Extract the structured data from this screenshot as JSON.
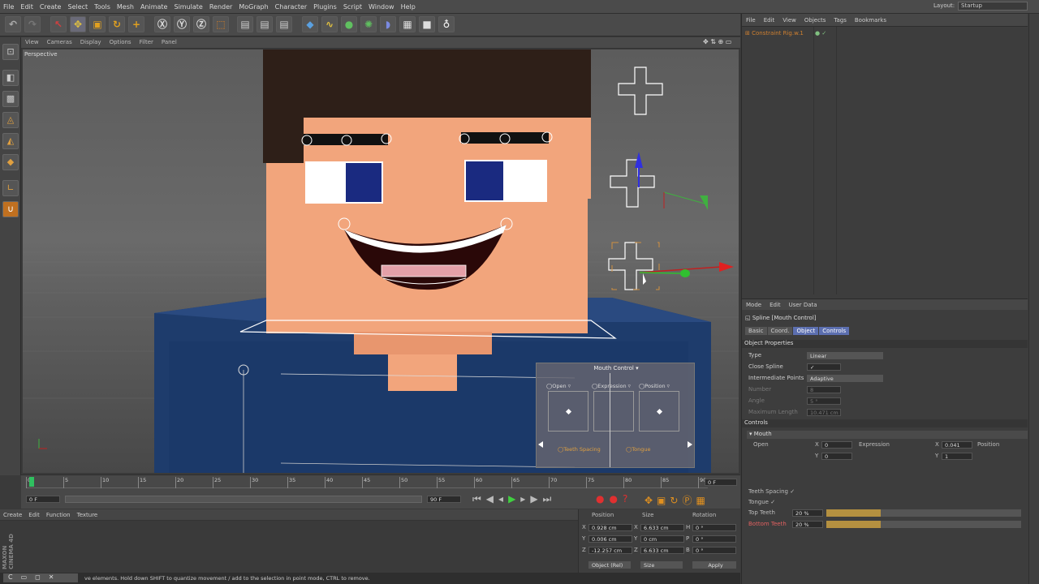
{
  "menu": [
    "File",
    "Edit",
    "Create",
    "Select",
    "Tools",
    "Mesh",
    "Animate",
    "Simulate",
    "Render",
    "MoGraph",
    "Character",
    "Plugins",
    "Script",
    "Window",
    "Help"
  ],
  "layout": {
    "label": "Layout:",
    "value": "Startup"
  },
  "viewport": {
    "menu": [
      "View",
      "Cameras",
      "Display",
      "Options",
      "Filter",
      "Panel"
    ],
    "title": "Perspective"
  },
  "mouth_control": {
    "title": "Mouth Control",
    "open": "Open",
    "expression": "Expression",
    "position": "Position",
    "teeth_spacing": "Teeth Spacing",
    "tongue": "Tongue"
  },
  "timeline": {
    "ticks": [
      "0",
      "5",
      "10",
      "15",
      "20",
      "25",
      "30",
      "35",
      "40",
      "45",
      "50",
      "55",
      "60",
      "65",
      "70",
      "75",
      "80",
      "85",
      "90"
    ],
    "start": "0 F",
    "end": "90 F",
    "current": "0 F",
    "fps_field": "0 F"
  },
  "bottom": {
    "menu": [
      "Create",
      "Edit",
      "Function",
      "Texture"
    ],
    "headers": {
      "position": "Position",
      "size": "Size",
      "rotation": "Rotation"
    },
    "rows": [
      {
        "axis": "X",
        "pos": "0.928 cm",
        "s": "X",
        "size": "6.633 cm",
        "r": "H",
        "rot": "0 °"
      },
      {
        "axis": "Y",
        "pos": "0.006 cm",
        "s": "Y",
        "size": "0 cm",
        "r": "P",
        "rot": "0 °"
      },
      {
        "axis": "Z",
        "pos": "-12.257 cm",
        "s": "Z",
        "size": "6.633 cm",
        "r": "B",
        "rot": "0 °"
      }
    ],
    "coord_mode": "Object (Rel)",
    "size_mode": "Size",
    "apply": "Apply",
    "status": "ve elements. Hold down SHIFT to quantize movement / add to the selection in point mode, CTRL to remove.",
    "brand": "MAXON CINEMA 4D"
  },
  "objects": {
    "menu": [
      "File",
      "Edit",
      "View",
      "Objects",
      "Tags",
      "Bookmarks"
    ],
    "item": "Constraint Rig.w.1"
  },
  "attributes": {
    "menu": [
      "Mode",
      "Edit",
      "User Data"
    ],
    "title": "Spline [Mouth Control]",
    "tabs": [
      "Basic",
      "Coord.",
      "Object",
      "Controls"
    ],
    "object_props": "Object Properties",
    "props": [
      {
        "label": "Type",
        "value": "Linear"
      },
      {
        "label": "Close Spline",
        "value": "✓"
      },
      {
        "label": "Intermediate Points",
        "value": "Adaptive"
      },
      {
        "label": "Number",
        "value": "8"
      },
      {
        "label": "Angle",
        "value": "5 °"
      },
      {
        "label": "Maximum Length",
        "value": "10.471 cm"
      }
    ],
    "controls": "Controls",
    "mouth": "Mouth",
    "open": "Open",
    "expression": "Expression",
    "position": "Position",
    "x1": "0",
    "y1": "0",
    "x2": "0.041",
    "y2": "1",
    "teeth_spacing": "Teeth Spacing",
    "tongue": "Tongue",
    "top_teeth": "Top Teeth",
    "top_val": "20 %",
    "bottom_teeth": "Bottom Teeth",
    "bottom_val": "20 %"
  }
}
